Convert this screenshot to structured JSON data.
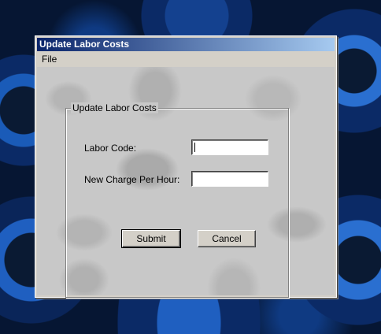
{
  "window": {
    "title": "Update Labor Costs"
  },
  "menu": {
    "file_label": "File"
  },
  "form": {
    "group_title": "Update Labor Costs",
    "labor_code": {
      "label": "Labor Code:",
      "value": ""
    },
    "new_charge": {
      "label": "New Charge Per Hour:",
      "value": ""
    },
    "submit_label": "Submit",
    "cancel_label": "Cancel"
  },
  "colors": {
    "titlebar_start": "#0a246a",
    "titlebar_end": "#a6caf0",
    "window_face": "#d4d0c8"
  }
}
